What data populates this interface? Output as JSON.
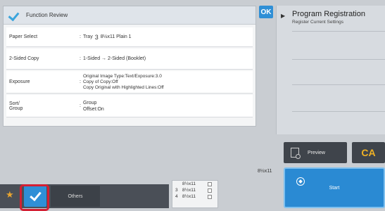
{
  "review": {
    "title": "Function Review",
    "rows": [
      {
        "label": "Paper Select",
        "tray_prefix": "Tray",
        "tray_num": "3",
        "detail": "8½x11  Plain 1"
      },
      {
        "label": "2-Sided Copy",
        "value": "1-Sided → 2-Sided (Booklet)"
      },
      {
        "label": "Exposure",
        "lines": [
          "Original Image Type:Text/Exposure:3.0",
          "Copy of Copy:Off",
          "Copy Original with Highlighted Lines:Off"
        ]
      },
      {
        "label": "Sort/\nGroup",
        "lines": [
          "Group",
          "Offset:On"
        ]
      }
    ]
  },
  "ok_label": "OK",
  "program": {
    "title": "Program Registration",
    "subtitle": "Register Current Settings"
  },
  "bottom": {
    "others_label": "Others"
  },
  "trays": [
    {
      "num": "",
      "size": "8½x11"
    },
    {
      "num": "3",
      "size": "8½x11"
    },
    {
      "num": "4",
      "size": "8½x11"
    }
  ],
  "paper_size": "8½x11",
  "buttons": {
    "preview": "Preview",
    "ca": "CA",
    "start": "Start"
  },
  "colors": {
    "accent": "#2f8fd6",
    "highlight": "#d41f33",
    "ca_text": "#f0b225"
  }
}
